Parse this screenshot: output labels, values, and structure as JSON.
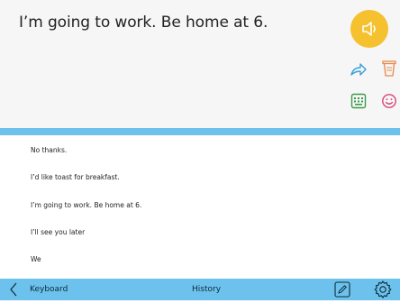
{
  "message": "I’m going to work. Be home at 6.",
  "icons": {
    "speak": "speaker-icon",
    "share": "share-arrow-icon",
    "trash": "trash-icon",
    "keyboard": "keyboard-icon",
    "emoji": "smiley-icon",
    "back": "chevron-left-icon",
    "edit": "pencil-icon",
    "settings": "gear-icon"
  },
  "colors": {
    "accent": "#6cc2ec",
    "speak": "#f6c12e",
    "share": "#3aa0d8",
    "trash": "#e88a4a",
    "keyboard": "#3b9a4a",
    "emoji": "#d8457a"
  },
  "history": [
    "No thanks.",
    "I’d like toast for breakfast.",
    "I’m going to work. Be home at 6.",
    "I’ll see you later",
    "We"
  ],
  "bottom": {
    "keyboard_label": "Keyboard",
    "history_label": "History"
  }
}
